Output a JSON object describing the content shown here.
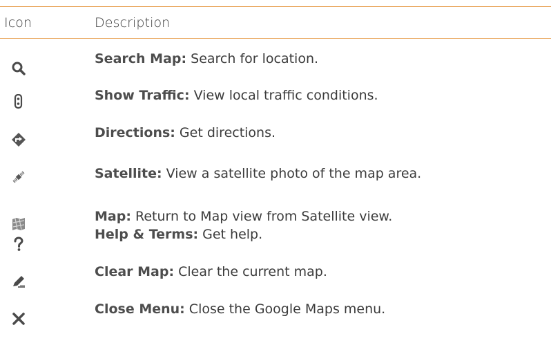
{
  "table": {
    "header": {
      "icon_label": "Icon",
      "description_label": "Description"
    },
    "rows": [
      {
        "icon": "search-icon",
        "term": "Search Map:",
        "text": " Search for location."
      },
      {
        "icon": "traffic-light-icon",
        "term": "Show Traffic:",
        "text": " View local traffic conditions."
      },
      {
        "icon": "directions-icon",
        "term": "Directions:",
        "text": " Get directions."
      },
      {
        "icon": "satellite-icon",
        "term": "Satellite:",
        "text": " View a satellite photo of the map area."
      },
      {
        "icon": "map-icon",
        "term": "Map:",
        "text": " Return to Map view from Satellite view."
      },
      {
        "icon": "help-icon",
        "term": "Help & Terms:",
        "text": " Get help."
      },
      {
        "icon": "clear-map-icon",
        "term": "Clear Map:",
        "text": " Clear the current map."
      },
      {
        "icon": "close-icon",
        "term": "Close Menu:",
        "text": " Close the Google Maps menu."
      }
    ]
  },
  "colors": {
    "rule": "#e9a55a",
    "text": "#3b3b3b"
  }
}
